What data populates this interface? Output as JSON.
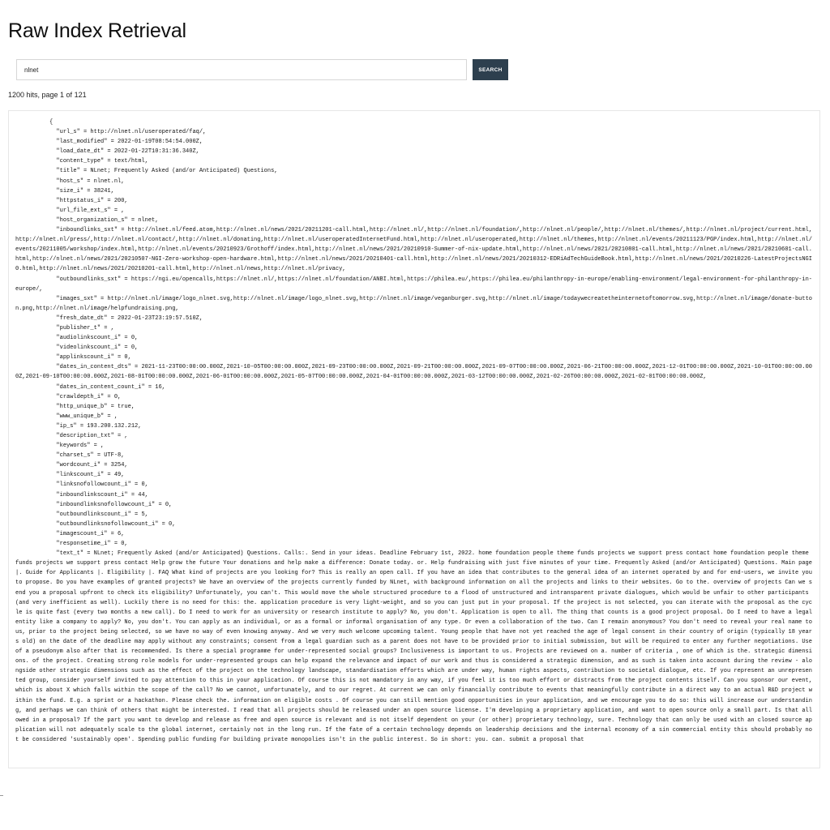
{
  "page_title": "Raw Index Retrieval",
  "search": {
    "value": "nlnet",
    "placeholder": "",
    "button_label": "SEARCH"
  },
  "results_summary": "1200 hits, page 1 of 121",
  "raw_record": "          {\n            \"url_s\" = http://nlnet.nl/useroperated/faq/,\n            \"last_modified\" = 2022-01-19T08:54:54.000Z,\n            \"load_date_dt\" = 2022-01-22T10:31:36.340Z,\n            \"content_type\" = text/html,\n            \"title\" = NLnet; Frequently Asked (and/or Anticipated) Questions,\n            \"host_s\" = nlnet.nl,\n            \"size_i\" = 38241,\n            \"httpstatus_i\" = 200,\n            \"url_file_ext_s\" = ,\n            \"host_organization_s\" = nlnet,\n            \"inboundlinks_sxt\" = http://nlnet.nl/feed.atom,http://nlnet.nl/news/2021/20211201-call.html,http://nlnet.nl/,http://nlnet.nl/foundation/,http://nlnet.nl/people/,http://nlnet.nl/themes/,http://nlnet.nl/project/current.html,http://nlnet.nl/press/,http://nlnet.nl/contact/,http://nlnet.nl/donating,http://nlnet.nl/useroperatedInternetFund.html,http://nlnet.nl/useroperated,http://nlnet.nl/themes,http://nlnet.nl/events/20211123/PGP/index.html,http://nlnet.nl/events/20211005/workshop/index.html,http://nlnet.nl/events/20210923/Grothoff/index.html,http://nlnet.nl/news/2021/20210910-Summer-of-nix-update.html,http://nlnet.nl/news/2021/20210801-call.html,http://nlnet.nl/news/2021/20210601-call.html,http://nlnet.nl/news/2021/20210507-NGI-Zero-workshop-open-hardware.html,http://nlnet.nl/news/2021/20210401-call.html,http://nlnet.nl/news/2021/20210312-EDRiAdTechGuideBook.html,http://nlnet.nl/news/2021/20210226-LatestProjectsNGI0.html,http://nlnet.nl/news/2021/20210201-call.html,http://nlnet.nl/news,http://nlnet.nl/privacy,\n            \"outboundlinks_sxt\" = https://ngi.eu/opencalls,https://nlnet.nl/,https://nlnet.nl/foundation/ANBI.html,https://philea.eu/,https://philea.eu/philanthropy-in-europe/enabling-environment/legal-environment-for-philanthropy-in-europe/,\n            \"images_sxt\" = http://nlnet.nl/image/logo_nlnet.svg,http://nlnet.nl/image/logo_nlnet.svg,http://nlnet.nl/image/veganburger.svg,http://nlnet.nl/image/todaywecreatetheinternetoftomorrow.svg,http://nlnet.nl/image/donate-button.png,http://nlnet.nl/image/helpfundraising.png,\n            \"fresh_date_dt\" = 2022-01-23T23:19:57.510Z,\n            \"publisher_t\" = ,\n            \"audiolinkscount_i\" = 0,\n            \"videolinkscount_i\" = 0,\n            \"applinkscount_i\" = 0,\n            \"dates_in_content_dts\" = 2021-11-23T00:00:00.000Z,2021-10-05T00:00:00.000Z,2021-09-23T00:00:00.000Z,2021-09-21T00:00:00.000Z,2021-09-07T00:00:00.000Z,2021-06-21T00:00:00.000Z,2021-12-01T00:00:00.000Z,2021-10-01T00:00:00.000Z,2021-09-10T00:00:00.000Z,2021-08-01T00:00:00.000Z,2021-06-01T00:00:00.000Z,2021-05-07T00:00:00.000Z,2021-04-01T00:00:00.000Z,2021-03-12T00:00:00.000Z,2021-02-26T00:00:00.000Z,2021-02-01T00:00:00.000Z,\n            \"dates_in_content_count_i\" = 16,\n            \"crawldepth_i\" = 0,\n            \"http_unique_b\" = true,\n            \"www_unique_b\" = ,\n            \"ip_s\" = 193.200.132.212,\n            \"description_txt\" = ,\n            \"keywords\" = ,\n            \"charset_s\" = UTF-8,\n            \"wordcount_i\" = 3254,\n            \"linkscount_i\" = 49,\n            \"linksnofollowcount_i\" = 0,\n            \"inboundlinkscount_i\" = 44,\n            \"inboundlinksnofollowcount_i\" = 0,\n            \"outboundlinkscount_i\" = 5,\n            \"outboundlinksnofollowcount_i\" = 0,\n            \"imagescount_i\" = 6,\n            \"responsetime_i\" = 0,\n            \"text_t\" = NLnet; Frequently Asked (and/or Anticipated) Questions. Calls:. Send in your ideas. Deadline February 1st, 2022. home foundation people theme funds projects we support press contact home foundation people theme funds projects we support press contact Help grow the future Your donations and help make a difference: Donate today. or. Help fundraising with just five minutes of your time. Frequently Asked (and/or Anticipated) Questions. Main page |. Guide for Applicants |. Eligibility |. FAQ What kind of projects are you looking for? This is really an open call. If you have an idea that contributes to the general idea of an internet operated by and for end-users, we invite you to propose. Do you have examples of granted projects? We have an overview of the projects currently funded by NLnet, with background information on all the projects and links to their websites. Go to the. overview of projects Can we send you a proposal upfront to check its eligibility? Unfortunately, you can't. This would move the whole structured procedure to a flood of unstructured and intransparent private dialogues, which would be unfair to other participants (and very inefficient as well). Luckily there is no need for this: the. application procedure is very light-weight, and so you can just put in your proposal. If the project is not selected, you can iterate with the proposal as the cycle is quite fast (every two months a new call). Do I need to work for an university or research institute to apply? No, you don't. Application is open to all. The thing that counts is a good project proposal. Do I need to have a legal entity like a company to apply? No, you don't. You can apply as an individual, or as a formal or informal organisation of any type. Or even a collaboration of the two. Can I remain anonymous? You don't need to reveal your real name to us, prior to the project being selected, so we have no way of even knowing anyway. And we very much welcome upcoming talent. Young people that have not yet reached the age of legal consent in their country of origin (typically 18 years old) on the date of the deadline may apply without any constraints; consent from a legal guardian such as a parent does not have to be provided prior to initial submission, but will be required to enter any further negotiations. Use of a pseudonym also after that is recommended. Is there a special programme for under-represented social groups? Inclusiveness is important to us. Projects are reviewed on a. number of criteria , one of which is the. strategic dimensions. of the project. Creating strong role models for under-represented groups can help expand the relevance and impact of our work and thus is considered a strategic dimension, and as such is taken into account during the review - alongside other strategic dimensions such as the effect of the project on the technology landscape, standardisation efforts which are under way, human rights aspects, contribution to societal dialogue, etc. If you represent an unrepresented group, consider yourself invited to pay attention to this in your application. Of course this is not mandatory in any way, if you feel it is too much effort or distracts from the project contents itself. Can you sponsor our event, which is about X which falls within the scope of the call? No we cannot, unfortunately, and to our regret. At current we can only financially contribute to events that meaningfully contribute in a direct way to an actual R&D project within the fund. E.g. a sprint or a hackathon. Please check the. information on eligible costs . Of course you can still mention good opportunities in your application, and we encourage you to do so: this will increase our understanding, and perhaps we can think of others that might be interested. I read that all projects should be released under an open source license. I'm developing a proprietary application, and want to open source only a small part. Is that allowed in a proposal? If the part you want to develop and release as free and open source is relevant and is not itself dependent on your (or other) proprietary technology, sure. Technology that can only be used with an closed source application will not adequately scale to the global internet, certainly not in the long run. If the fate of a certain technology depends on leadership decisions and the internal economy of a sin commercial entity this should probably not be considered 'sustainably open'. Spending public funding for building private monopolies isn't in the public interest. So in short: you. can. submit a proposal that"
}
